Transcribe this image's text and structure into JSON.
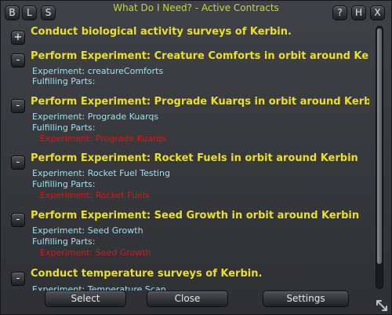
{
  "window": {
    "title": "What Do I Need? - Active Contracts"
  },
  "header_buttons": {
    "b": "B",
    "l": "L",
    "s": "S",
    "help": "?",
    "h": "H",
    "close": "X"
  },
  "contracts": [
    {
      "toggle": "+",
      "title": "Conduct biological activity surveys of Kerbin.",
      "lines": []
    },
    {
      "toggle": "-",
      "title": "Perform Experiment: Creature Comforts in orbit around Kerbin",
      "lines": [
        "Experiment:  creatureComforts",
        "Fulfilling Parts:"
      ],
      "red": []
    },
    {
      "toggle": "-",
      "title": "Perform Experiment: Prograde Kuarqs in orbit around Kerbin",
      "lines": [
        "Experiment:  Prograde Kuarqs",
        "Fulfilling Parts:"
      ],
      "red": [
        "Experiment: Prograde Kuarqs"
      ]
    },
    {
      "toggle": "-",
      "title": "Perform Experiment: Rocket Fuels in orbit around Kerbin",
      "lines": [
        "Experiment:  Rocket Fuel Testing",
        "Fulfilling Parts:"
      ],
      "red": [
        "Experiment: Rocket Fuels"
      ]
    },
    {
      "toggle": "-",
      "title": "Perform Experiment: Seed Growth in orbit around Kerbin",
      "lines": [
        "Experiment:  Seed Growth",
        "Fulfilling Parts:"
      ],
      "red": [
        "Experiment: Seed Growth"
      ]
    },
    {
      "toggle": "-",
      "title": "Conduct temperature surveys of Kerbin.",
      "lines": [
        "Experiment:  Temperature Scan"
      ],
      "red": []
    }
  ],
  "footer": {
    "select": "Select",
    "close": "Close",
    "settings": "Settings"
  },
  "icons": {
    "resize": "resize-grip-icon"
  }
}
